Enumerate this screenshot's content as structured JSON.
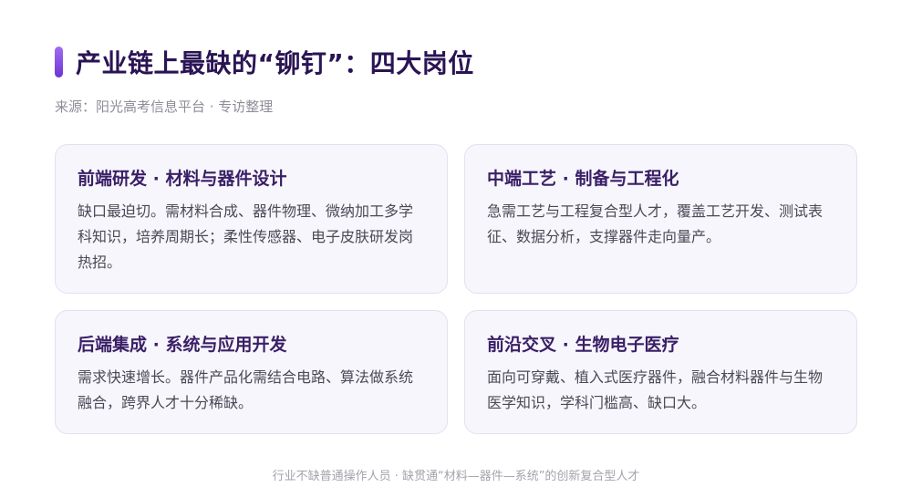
{
  "header": {
    "title": "产业链上最缺的“铆钉”：四大岗位",
    "source": "来源：阳光高考信息平台 · 专访整理",
    "accent_color": "#7b45e0"
  },
  "cards": [
    {
      "title": "前端研发 · 材料与器件设计",
      "body": "缺口最迫切。需材料合成、器件物理、微纳加工多学科知识，培养周期长；柔性传感器、电子皮肤研发岗热招。"
    },
    {
      "title": "中端工艺 · 制备与工程化",
      "body": "急需工艺与工程复合型人才，覆盖工艺开发、测试表征、数据分析，支撑器件走向量产。"
    },
    {
      "title": "后端集成 · 系统与应用开发",
      "body": "需求快速增长。器件产品化需结合电路、算法做系统融合，跨界人才十分稀缺。"
    },
    {
      "title": "前沿交叉 · 生物电子医疗",
      "body": "面向可穿戴、植入式医疗器件，融合材料器件与生物医学知识，学科门槛高、缺口大。"
    }
  ],
  "footer": {
    "text": "行业不缺普通操作人员 · 缺贯通“材料—器件—系统”的创新复合型人才"
  }
}
